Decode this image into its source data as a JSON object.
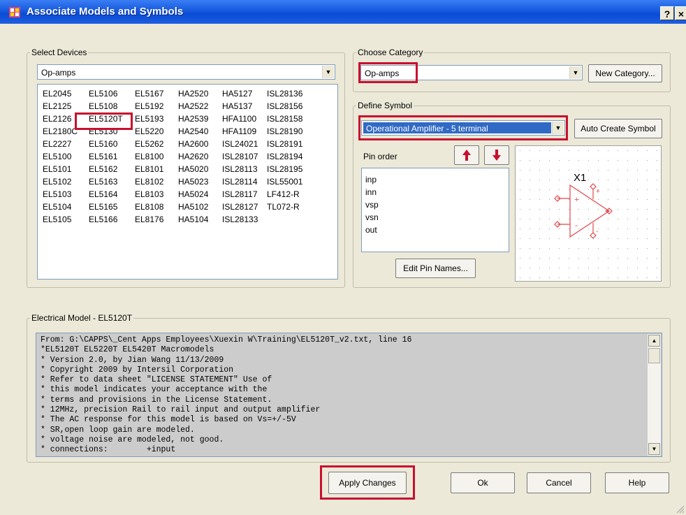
{
  "window": {
    "title": "Associate Models and Symbols",
    "help_button": "?",
    "close_button": "×"
  },
  "select_devices": {
    "legend": "Select Devices",
    "combo_value": "Op-amps",
    "devices": [
      [
        "EL2045",
        "EL5106",
        "EL5167",
        "HA2520",
        "HA5127",
        "ISL28136"
      ],
      [
        "EL2125",
        "EL5108",
        "EL5192",
        "HA2522",
        "HA5137",
        "ISL28156"
      ],
      [
        "EL2126",
        "EL5120T",
        "EL5193",
        "HA2539",
        "HFA1100",
        "ISL28158"
      ],
      [
        "EL2180C",
        "EL5130",
        "EL5220",
        "HA2540",
        "HFA1109",
        "ISL28190"
      ],
      [
        "EL2227",
        "EL5160",
        "EL5262",
        "HA2600",
        "ISL24021",
        "ISL28191"
      ],
      [
        "EL5100",
        "EL5161",
        "EL8100",
        "HA2620",
        "ISL28107",
        "ISL28194"
      ],
      [
        "EL5101",
        "EL5162",
        "EL8101",
        "HA5020",
        "ISL28113",
        "ISL28195"
      ],
      [
        "EL5102",
        "EL5163",
        "EL8102",
        "HA5023",
        "ISL28114",
        "ISL55001"
      ],
      [
        "EL5103",
        "EL5164",
        "EL8103",
        "HA5024",
        "ISL28117",
        "LF412-R"
      ],
      [
        "EL5104",
        "EL5165",
        "EL8108",
        "HA5102",
        "ISL28127",
        "TL072-R"
      ],
      [
        "EL5105",
        "EL5166",
        "EL8176",
        "HA5104",
        "ISL28133",
        ""
      ]
    ],
    "selected_device": "EL5120T"
  },
  "choose_category": {
    "legend": "Choose Category",
    "combo_value": "Op-amps",
    "new_category_label": "New Category..."
  },
  "define_symbol": {
    "legend": "Define Symbol",
    "combo_value": "Operational Amplifier - 5 terminal",
    "auto_create_label": "Auto Create Symbol",
    "pin_order_label": "Pin order",
    "pins": [
      "inp",
      "inn",
      "vsp",
      "vsn",
      "out"
    ],
    "edit_pin_names_label": "Edit Pin Names...",
    "symbol_ref": "X1",
    "plus_sign": "+",
    "minus_sign": "-"
  },
  "electrical_model": {
    "legend": "Electrical Model - EL5120T",
    "lines": [
      "From: G:\\CAPPS\\_Cent Apps Employees\\Xuexin W\\Training\\EL5120T_v2.txt, line 16",
      "*EL5120T EL5220T EL5420T Macromodels",
      "* Version 2.0, by Jian Wang 11/13/2009",
      "* Copyright 2009 by Intersil Corporation",
      "* Refer to data sheet \"LICENSE STATEMENT\" Use of",
      "* this model indicates your acceptance with the",
      "* terms and provisions in the License Statement.",
      "* 12MHz, precision Rail to rail input and output amplifier",
      "* The AC response for this model is based on Vs=+/-5V",
      "* SR,open loop gain are modeled.",
      "* voltage noise are modeled, not good.",
      "* connections:        +input"
    ]
  },
  "footer": {
    "apply_label": "Apply Changes",
    "ok_label": "Ok",
    "cancel_label": "Cancel",
    "help_label": "Help"
  },
  "colors": {
    "highlight_box": "#c8102e",
    "selection_blue": "#316ac5",
    "title_blue": "#0a4bd6",
    "arrow_red": "#c8102e"
  }
}
